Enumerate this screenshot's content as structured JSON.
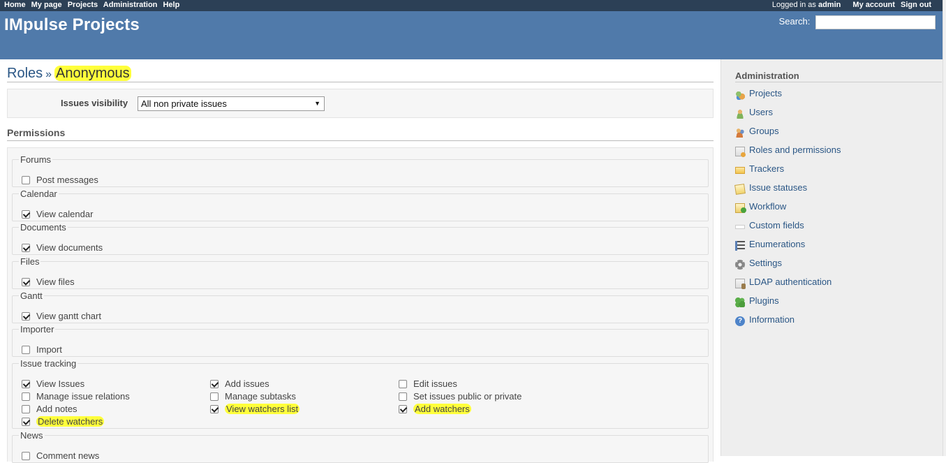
{
  "top_menu": {
    "left": [
      "Home",
      "My page",
      "Projects",
      "Administration",
      "Help"
    ],
    "logged_in_prefix": "Logged in as",
    "logged_in_user": "admin",
    "my_account": "My account",
    "sign_out": "Sign out"
  },
  "header": {
    "title": "IMpulse Projects",
    "search_label": "Search:",
    "search_value": ""
  },
  "page": {
    "breadcrumb_root": "Roles",
    "separator": "»",
    "current": "Anonymous"
  },
  "issues_visibility": {
    "label": "Issues visibility",
    "selected": "All non private issues"
  },
  "permissions": {
    "title": "Permissions",
    "modules": [
      {
        "name": "Forums",
        "items": [
          {
            "label": "Post messages",
            "checked": false
          }
        ]
      },
      {
        "name": "Calendar",
        "items": [
          {
            "label": "View calendar",
            "checked": true
          }
        ]
      },
      {
        "name": "Documents",
        "items": [
          {
            "label": "View documents",
            "checked": true
          }
        ]
      },
      {
        "name": "Files",
        "items": [
          {
            "label": "View files",
            "checked": true
          }
        ]
      },
      {
        "name": "Gantt",
        "items": [
          {
            "label": "View gantt chart",
            "checked": true
          }
        ]
      },
      {
        "name": "Importer",
        "items": [
          {
            "label": "Import",
            "checked": false
          }
        ]
      },
      {
        "name": "Issue tracking",
        "items": [
          {
            "label": "View Issues",
            "checked": true
          },
          {
            "label": "Add issues",
            "checked": true
          },
          {
            "label": "Edit issues",
            "checked": false
          },
          {
            "label": "Manage issue relations",
            "checked": false
          },
          {
            "label": "Manage subtasks",
            "checked": false
          },
          {
            "label": "Set issues public or private",
            "checked": false
          },
          {
            "label": "Add notes",
            "checked": false
          },
          {
            "label": "View watchers list",
            "checked": true,
            "highlight": true
          },
          {
            "label": "Add watchers",
            "checked": true,
            "highlight": true
          },
          {
            "label": "Delete watchers",
            "checked": true,
            "highlight": true
          }
        ]
      },
      {
        "name": "News",
        "items": [
          {
            "label": "Comment news",
            "checked": false
          }
        ]
      }
    ]
  },
  "sidebar": {
    "title": "Administration",
    "items": [
      {
        "label": "Projects",
        "icon": "projects-icon"
      },
      {
        "label": "Users",
        "icon": "user-icon"
      },
      {
        "label": "Groups",
        "icon": "group-icon"
      },
      {
        "label": "Roles and permissions",
        "icon": "roles-icon"
      },
      {
        "label": "Trackers",
        "icon": "trackers-icon"
      },
      {
        "label": "Issue statuses",
        "icon": "issue-status-icon"
      },
      {
        "label": "Workflow",
        "icon": "workflow-icon"
      },
      {
        "label": "Custom fields",
        "icon": "custom-fields-icon"
      },
      {
        "label": "Enumerations",
        "icon": "enumerations-icon"
      },
      {
        "label": "Settings",
        "icon": "settings-icon"
      },
      {
        "label": "LDAP authentication",
        "icon": "ldap-icon"
      },
      {
        "label": "Plugins",
        "icon": "plugins-icon"
      },
      {
        "label": "Information",
        "icon": "info-icon"
      }
    ]
  },
  "colors": {
    "top_menu_bg": "#2c4056",
    "header_bg": "#507aaa",
    "link": "#2a5685",
    "highlight": "#ffff3b"
  }
}
